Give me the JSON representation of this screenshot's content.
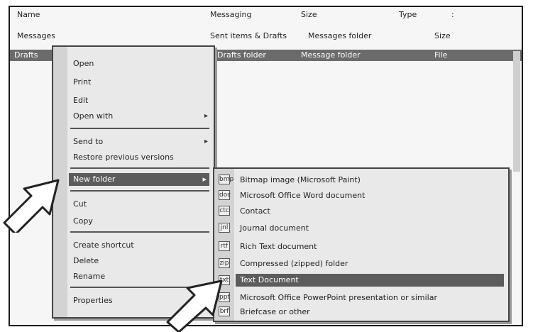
{
  "header": {
    "name": "Name",
    "col2": "Messaging",
    "col3": "Size",
    "col4": "Type",
    "col5": ":"
  },
  "subheader": {
    "name": "Messages",
    "col2": "Sent items & Drafts",
    "col3": "Messages folder",
    "col4": "Size"
  },
  "selected_row": {
    "name": "Drafts",
    "col2": "Drafts folder",
    "col3": "Message folder",
    "col4": "File"
  },
  "context_menu": {
    "items": [
      {
        "label": "Open",
        "arrow": ""
      },
      {
        "label": "Print",
        "arrow": ""
      },
      {
        "label": "Edit",
        "arrow": ""
      },
      {
        "label": "Open with",
        "arrow": "▸"
      },
      {
        "label": "Send to",
        "arrow": "▸"
      },
      {
        "label": "Restore previous versions",
        "arrow": ""
      },
      {
        "label": "New folder",
        "arrow": "▸"
      },
      {
        "label": "Cut",
        "arrow": ""
      },
      {
        "label": "Copy",
        "arrow": ""
      },
      {
        "label": "Create shortcut",
        "arrow": ""
      },
      {
        "label": "Delete",
        "arrow": ""
      },
      {
        "label": "Rename",
        "arrow": ""
      },
      {
        "label": "Properties",
        "arrow": ""
      }
    ]
  },
  "submenu": {
    "items": [
      {
        "label": "Bitmap image (Microsoft Paint)",
        "icon": "bmp"
      },
      {
        "label": "Microsoft Office Word document",
        "icon": "doc"
      },
      {
        "label": "Contact",
        "icon": "ctc"
      },
      {
        "label": "Journal document",
        "icon": "jnl"
      },
      {
        "label": "Rich Text document",
        "icon": "rtf"
      },
      {
        "label": "Compressed (zipped) folder",
        "icon": "zip"
      },
      {
        "label": "Text Document",
        "icon": "txt"
      },
      {
        "label": "Microsoft Office PowerPoint presentation or similar",
        "icon": "ppt"
      },
      {
        "label": "Briefcase or other",
        "icon": "brf"
      }
    ]
  },
  "colors": {
    "highlight": "#5c5c5c",
    "menu_bg": "#e9e9e9",
    "selected_row": "#6b6b6b",
    "annotation_arrow": "#ffffff"
  }
}
